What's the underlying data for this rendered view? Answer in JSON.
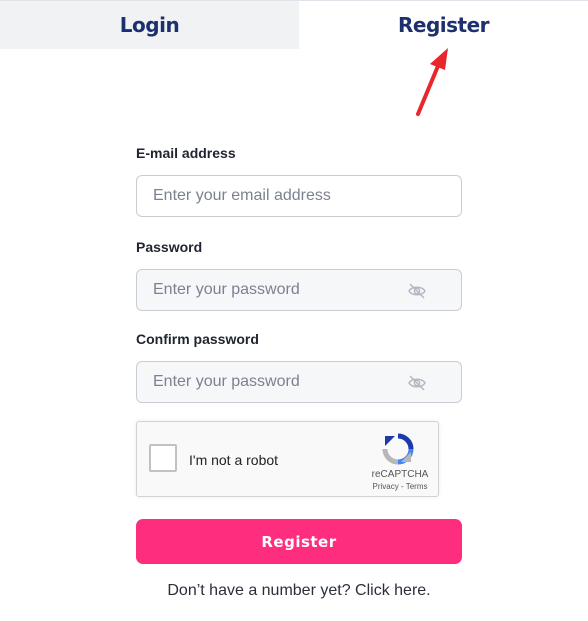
{
  "tabs": {
    "login": "Login",
    "register": "Register"
  },
  "form": {
    "email": {
      "label": "E-mail address",
      "placeholder": "Enter your email address"
    },
    "password": {
      "label": "Password",
      "placeholder": "Enter your password"
    },
    "confirm": {
      "label": "Confirm password",
      "placeholder": "Enter your password"
    }
  },
  "captcha": {
    "label": "I'm not a robot",
    "brand": "reCAPTCHA",
    "privacy": "Privacy",
    "separator": " - ",
    "terms": "Terms"
  },
  "submit_label": "Register",
  "footer_link": "Don’t have a number yet? Click here.",
  "colors": {
    "accent": "#fe2d7e",
    "tab_text": "#1d2f6e",
    "arrow": "#e8262b"
  },
  "icons": {
    "password_toggle": "eye-off-icon",
    "annotation": "red-arrow"
  }
}
